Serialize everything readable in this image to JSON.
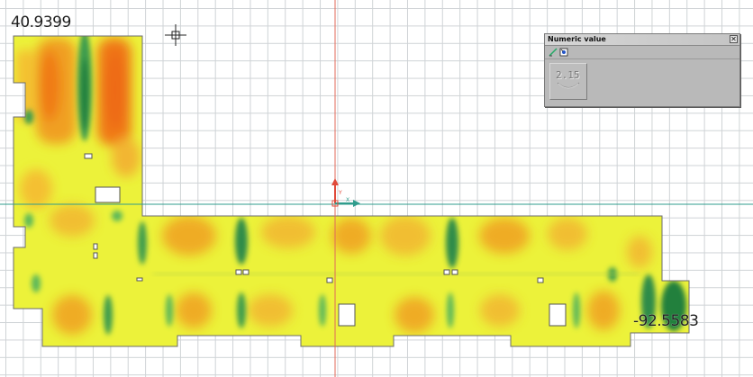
{
  "viewer": {
    "max_label": "40.9399",
    "min_label": "-92.5583",
    "colors": {
      "background": "#ffffff",
      "grid": "#cfd3d6",
      "slab_base": "#ecf23a",
      "warm": "#f0a020",
      "hot": "#f07a18",
      "cool": "#53b85a",
      "cold": "#2f8c4a",
      "axis_x": "#2f9c8c",
      "axis_y": "#e06a5a"
    }
  },
  "dialog": {
    "title": "Numeric value",
    "close_glyph": "✕",
    "value": "2.15",
    "toolbar_icons": [
      "draw-icon",
      "settings-icon"
    ]
  }
}
